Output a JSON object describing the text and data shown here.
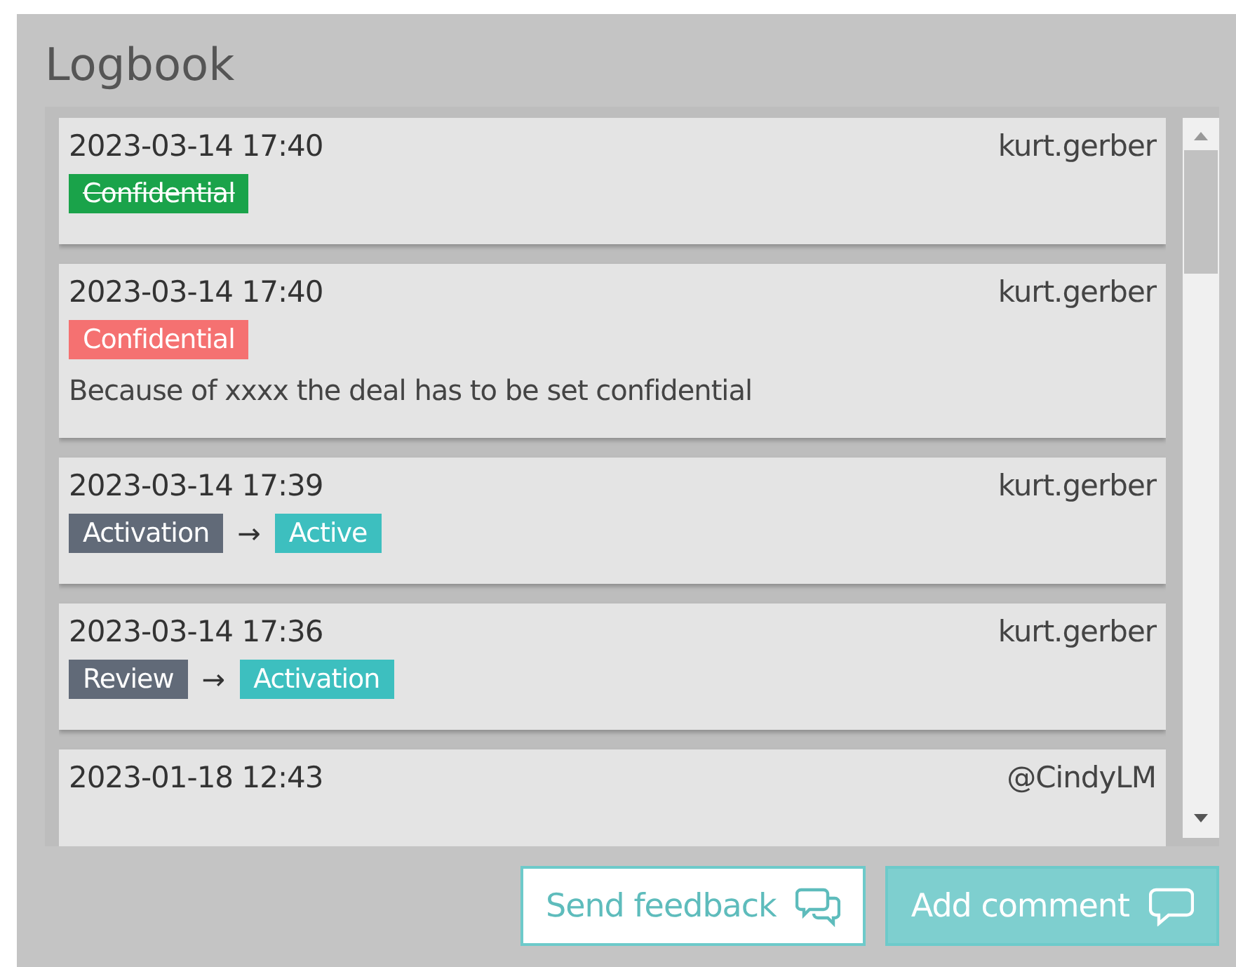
{
  "title": "Logbook",
  "entries": [
    {
      "time": "2023-03-14 17:40",
      "user": "kurt.gerber",
      "items": [
        {
          "kind": "tag",
          "label": "Confidential",
          "color": "#1aa34a",
          "struck": true
        }
      ]
    },
    {
      "time": "2023-03-14 17:40",
      "user": "kurt.gerber",
      "items": [
        {
          "kind": "tag",
          "label": "Confidential",
          "color": "#f57171",
          "struck": false
        }
      ],
      "comment": "Because of xxxx the deal has to be set confidential"
    },
    {
      "time": "2023-03-14 17:39",
      "user": "kurt.gerber",
      "items": [
        {
          "kind": "tag",
          "label": "Activation",
          "color": "#616a78",
          "struck": false
        },
        {
          "kind": "arrow",
          "text": "→"
        },
        {
          "kind": "tag",
          "label": "Active",
          "color": "#3dbfbf",
          "struck": false
        }
      ]
    },
    {
      "time": "2023-03-14 17:36",
      "user": "kurt.gerber",
      "items": [
        {
          "kind": "tag",
          "label": "Review",
          "color": "#616a78",
          "struck": false
        },
        {
          "kind": "arrow",
          "text": "→"
        },
        {
          "kind": "tag",
          "label": "Activation",
          "color": "#3dbfbf",
          "struck": false
        }
      ]
    },
    {
      "time": "2023-01-18 12:43",
      "user": "@CindyLM"
    }
  ],
  "buttons": [
    {
      "label": "Send feedback",
      "kind": "outline"
    },
    {
      "label": "Add comment",
      "kind": "filled"
    }
  ]
}
